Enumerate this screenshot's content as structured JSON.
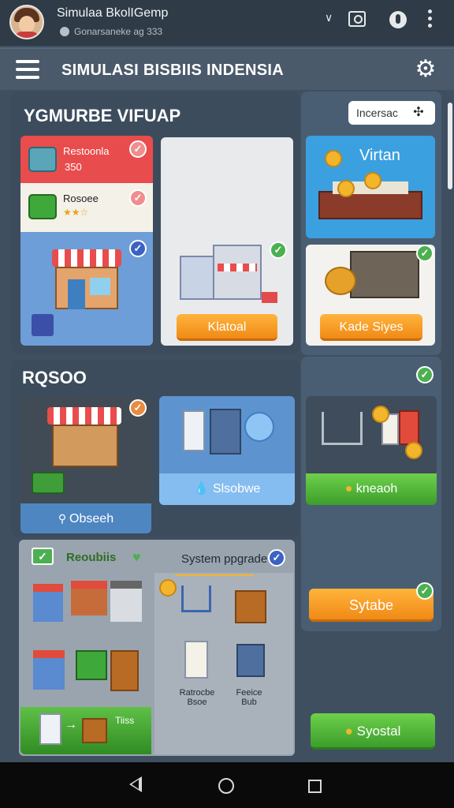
{
  "status": {
    "app_name": "Simulaa BkolIGemp",
    "subtitle": "Gonarsaneke ag 333"
  },
  "header": {
    "title": "SIMULASI BISBIIS INDENSIA"
  },
  "sections": {
    "top_title": "YGMURBE VIFUAP",
    "mid_title": "RQSOO"
  },
  "search": {
    "placeholder": "Incersac"
  },
  "cards": {
    "item1_name": "Restoonla",
    "item1_price": "350",
    "item2_name": "Rosoee",
    "item2_rating": "★★☆",
    "c2_button": "Klatoal",
    "c3_title": "Virtan",
    "c4_button": "Kade Siyes",
    "c5_button": "Obseeh",
    "c6_button": "Slsobwe",
    "c7_button": "kneaoh"
  },
  "features": {
    "label": "Reoubiis",
    "system_label": "System ppgrade",
    "bottom_label": "Tiiss",
    "upgrade_left_line1": "Ratrocbe",
    "upgrade_left_line2": "Bsoe",
    "upgrade_right_line1": "Feeice",
    "upgrade_right_line2": "Bub"
  },
  "buttons": {
    "sytabe": "Sytabe",
    "syostal": "Syostal"
  },
  "colors": {
    "bg": "#3f4f60",
    "accent_orange": "#f39a1e",
    "accent_green": "#4cb050",
    "accent_blue": "#3aa0e0"
  }
}
